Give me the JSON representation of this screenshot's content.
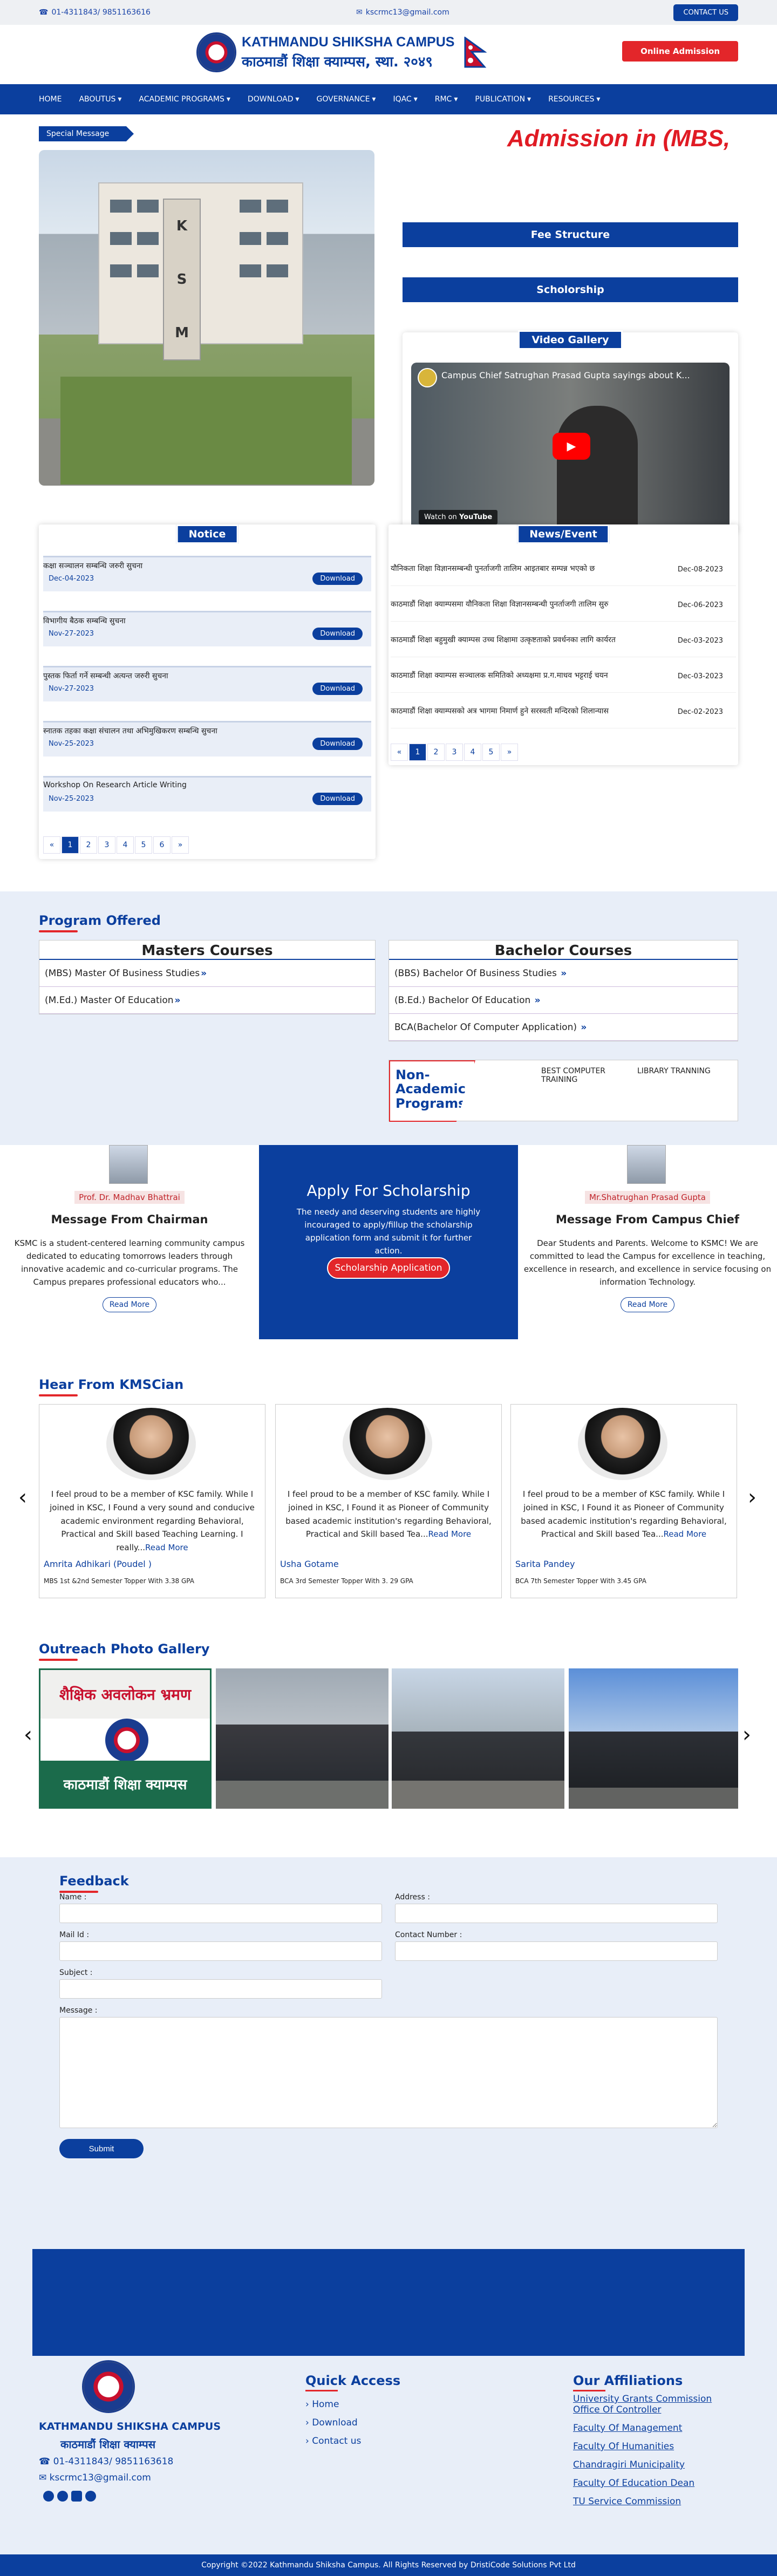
{
  "topbar": {
    "phone": "01-4311843/ 9851163616",
    "email": "kscrmc13@gmail.com",
    "contact_label": "CONTACT US"
  },
  "header": {
    "name_en": "KATHMANDU SHIKSHA CAMPUS",
    "name_np": "काठमाडौं शिक्षा क्याम्पस, स्था. २०४९",
    "admission_label": "Online Admission"
  },
  "nav": {
    "items": [
      "HOME",
      "ABOUTUS",
      "ACADEMIC PROGRAMS",
      "DOWNLOAD",
      "GOVERNANCE",
      "IQAC",
      "RMC",
      "PUBLICATION",
      "RESOURCES"
    ]
  },
  "hero": {
    "special_message": "Special Message",
    "marquee": "Admission in (MBS,",
    "fee_structure": "Fee Structure",
    "scholarship": "Scholorship",
    "video_gallery": "Video Gallery",
    "video_title": "Campus Chief Satrughan Prasad Gupta sayings about K...",
    "watch_on": "Watch on",
    "youtube": "YouTube"
  },
  "notice": {
    "title": "Notice",
    "items": [
      {
        "title": "कक्षा सञ्चालन सम्बन्धि जरुरी सुचना",
        "date": "Dec-04-2023",
        "action": "Download"
      },
      {
        "title": "विभागीय बैठक सम्बन्धि सुचना",
        "date": "Nov-27-2023",
        "action": "Download"
      },
      {
        "title": "पुस्तक फिर्ता गर्ने सम्बन्धी अत्यन्त जरुरी सुचना",
        "date": "Nov-27-2023",
        "action": "Download"
      },
      {
        "title": "स्नातक तहका कक्षा संचालन तथा अभिमुखिकरण सम्बन्धि सुचना",
        "date": "Nov-25-2023",
        "action": "Download"
      },
      {
        "title": "Workshop On Research Article Writing",
        "date": "Nov-25-2023",
        "action": "Download"
      }
    ],
    "pages": [
      "«",
      "1",
      "2",
      "3",
      "4",
      "5",
      "6",
      "»"
    ]
  },
  "news": {
    "title": "News/Event",
    "items": [
      {
        "title": "यौनिकता शिक्षा विज्ञानसम्बन्धी पुनर्ताजगी तालिम आइतबार सम्पन्न भएको छ",
        "date": "Dec-08-2023"
      },
      {
        "title": "काठमाडौं शिक्षा क्याम्पसमा यौनिकता शिक्षा विज्ञानसम्बन्धी पुनर्ताजगी तालिम सुरु",
        "date": "Dec-06-2023"
      },
      {
        "title": "काठमाडौं शिक्षा बहुमुखी क्याम्पस उच्च शिक्षामा उत्कृष्टताको प्रवर्धनका लागि कार्यरत",
        "date": "Dec-03-2023"
      },
      {
        "title": "काठमाडौं शिक्षा क्याम्पस सञ्चालक समितिको अध्यक्षमा प्र.ग.माधव भट्टराई चयन",
        "date": "Dec-03-2023"
      },
      {
        "title": "काठमाडौं शिक्षा क्याम्पसको अत्र भागमा निमार्ण हुने सरस्वती मन्दिरको शिलान्यास",
        "date": "Dec-02-2023"
      }
    ],
    "pages": [
      "«",
      "1",
      "2",
      "3",
      "4",
      "5",
      "»"
    ]
  },
  "programs": {
    "title": "Program Offered",
    "masters_head": "Masters Courses",
    "masters": [
      "(MBS) Master Of Business Studies",
      "(M.Ed.) Master Of Education"
    ],
    "bachelor_head": "Bachelor Courses",
    "bachelor": [
      "(BBS) Bachelor Of Business Studies",
      "(B.Ed.) Bachelor Of Education",
      "BCA(Bachelor Of Computer Application)"
    ],
    "arrow": "»",
    "nonacad_label": "Non-Academic Programs",
    "nonacad_items": [
      "BEST COMPUTER TRAINING",
      "LIBRARY TRANNING"
    ]
  },
  "messages": {
    "chairman_name": "Prof. Dr. Madhav Bhattrai",
    "chairman_role": "Message From Chairman",
    "chairman_body": "KSMC is a student-centered learning community campus dedicated to educating tomorrows leaders through innovative academic and co-curricular programs. The Campus prepares professional educators who...",
    "read_more": "Read More",
    "scholar_head": "Apply For Scholarship",
    "scholar_body": "The needy and deserving students are highly incouraged to apply/fillup the scholarship application form and submit it for further action.",
    "scholar_btn": "Scholarship Application",
    "chief_name": "Mr.Shatrughan Prasad Gupta",
    "chief_role": "Message From Campus Chief",
    "chief_body": "Dear Students and Parents. Welcome to KSMC! We are committed to lead the Campus for excellence in teaching, excellence in research, and excellence in service focusing on information Technology."
  },
  "hear": {
    "title": "Hear From KMSCian",
    "items": [
      {
        "quote": "I feel proud to be a member of KSC family. While I joined in KSC, I Found a very sound and conducive academic environment regarding Behavioral, Practical and Skill based Teaching Learning. I really...",
        "name": "Amrita Adhikari (Poudel )",
        "sub": "MBS 1st &2nd Semester Topper With 3.38 GPA"
      },
      {
        "quote": "I feel proud to be a member of KSC family. While I joined in KSC, I Found it as Pioneer of Community based academic institution's regarding Behavioral, Practical and Skill based Tea...",
        "name": "Usha Gotame",
        "sub": "BCA 3rd Semester Topper With 3. 29 GPA"
      },
      {
        "quote": "I feel proud to be a member of KSC family. While I joined in KSC, I Found it as Pioneer of Community based academic institution's regarding Behavioral, Practical and Skill based Tea...",
        "name": "Sarita Pandey",
        "sub": "BCA 7th Semester Topper With 3.45 GPA"
      }
    ],
    "read_more": "Read More"
  },
  "gallery": {
    "title": "Outreach Photo Gallery",
    "banner_top": "शैक्षिक अवलोकन भ्रमण",
    "banner_bottom": "काठमाडौं शिक्षा क्याम्पस"
  },
  "feedback": {
    "title": "Feedback",
    "name": "Name :",
    "address": "Address :",
    "mail": "Mail Id :",
    "contact": "Contact Number :",
    "subject": "Subject :",
    "message": "Message :",
    "submit": "Submit"
  },
  "footer": {
    "name_en": "KATHMANDU SHIKSHA CAMPUS",
    "name_np": "काठमाडौं शिक्षा क्याम्पस",
    "phone": "01-4311843/ 9851163618",
    "email": "kscrmc13@gmail.com",
    "quick_title": "Quick Access",
    "quick": [
      "Home",
      "Download",
      "Contact us"
    ],
    "aff_title": "Our Affiliations",
    "aff": [
      "University Grants Commission",
      "Office Of Controller",
      "Faculty Of Management",
      "Faculty Of Humanities",
      "Chandragiri Municipality",
      "Faculty Of Education Dean",
      "TU Service Commission"
    ],
    "copyright": "Copyright ©2022 Kathmandu Shiksha Campus. All Rights Reserved by DristiCode Solutions Pvt Ltd"
  }
}
